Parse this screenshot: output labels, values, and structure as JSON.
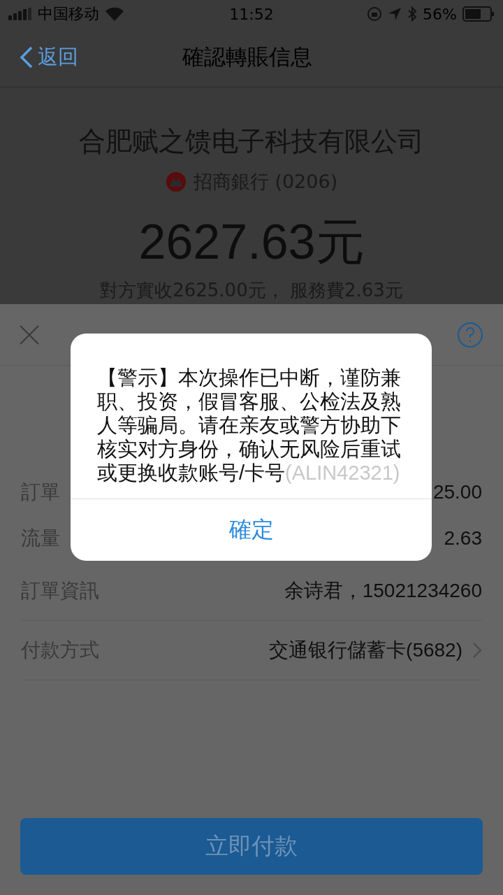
{
  "status_bar": {
    "carrier": "中国移动",
    "time": "11:52",
    "battery": "56%"
  },
  "nav": {
    "back": "返回",
    "title": "確認轉賬信息"
  },
  "payee": {
    "name": "合肥赋之馈电子科技有限公司",
    "bank": "招商銀行 (0206)",
    "amount": "2627.63元",
    "breakdown": "對方實收2625.00元， 服務費2.63元"
  },
  "sheet": {
    "rows": [
      {
        "label": "訂單",
        "value": "25.00",
        "chevron": false
      },
      {
        "label": "流量",
        "value": "2.63",
        "chevron": false
      },
      {
        "label": "訂單資訊",
        "value": "余诗君，15021234260",
        "chevron": false
      },
      {
        "label": "付款方式",
        "value": "交通银行儲蓄卡(5682)",
        "chevron": true
      }
    ],
    "pay_button": "立即付款"
  },
  "dialog": {
    "message": "【警示】本次操作已中断，谨防兼职、投资，假冒客服、公检法及熟人等骗局。请在亲友或警方协助下核实对方身份，确认无风险后重试或更换收款账号/卡号",
    "code": "(ALIN42321)",
    "button": "確定"
  }
}
